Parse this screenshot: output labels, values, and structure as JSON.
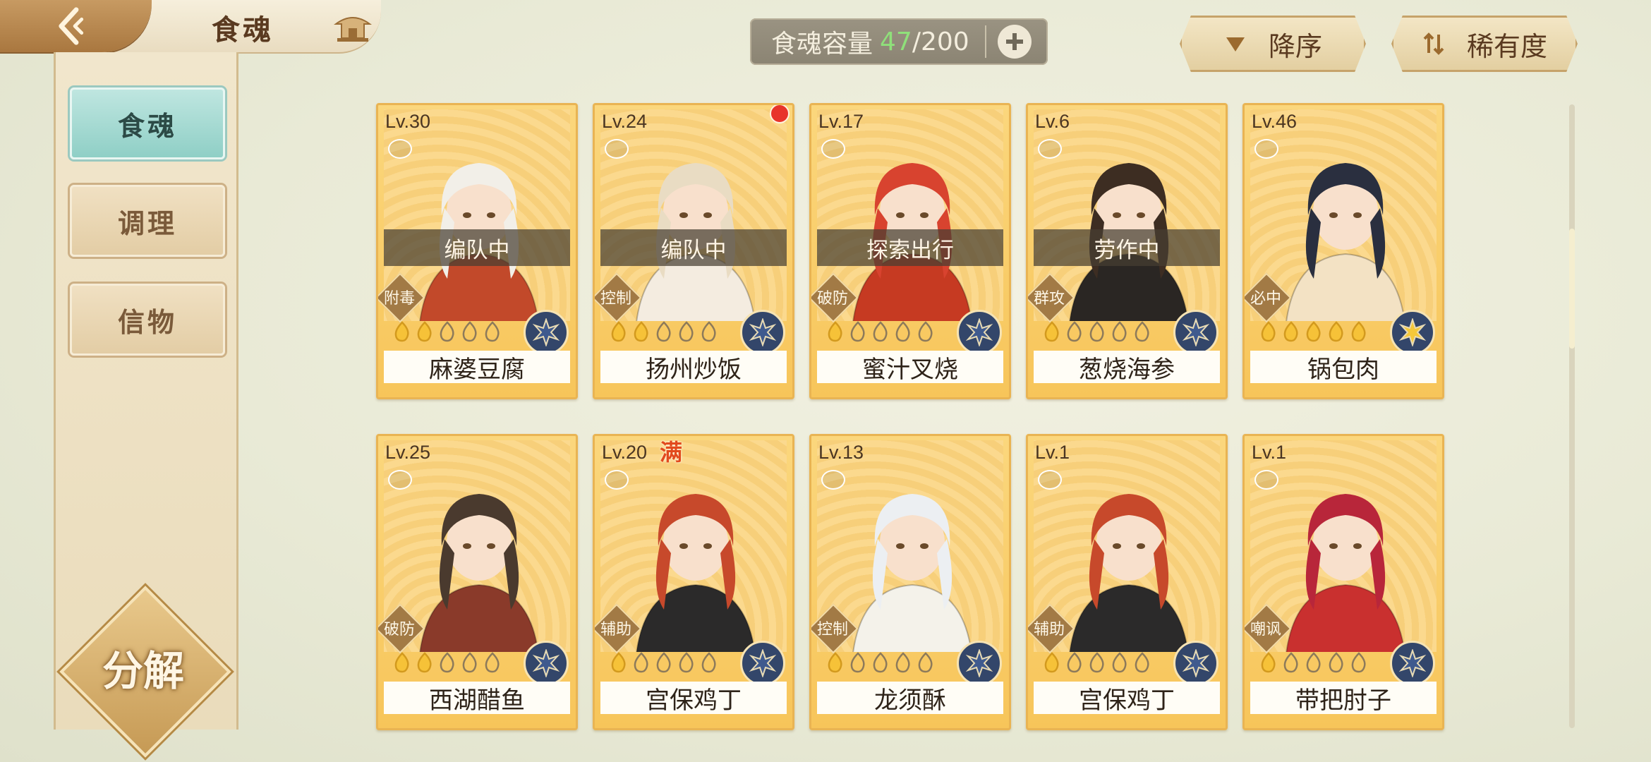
{
  "header": {
    "title": "食魂",
    "capacity_label": "食魂容量",
    "capacity_current": "47",
    "capacity_max": "/200",
    "sort_desc_label": "降序",
    "sort_rarity_label": "稀有度"
  },
  "sidebar": {
    "tabs": [
      {
        "label": "食魂",
        "active": true
      },
      {
        "label": "调理",
        "active": false
      },
      {
        "label": "信物",
        "active": false
      }
    ],
    "decompose_label": "分解"
  },
  "cards": [
    {
      "level": "Lv.30",
      "name": "麻婆豆腐",
      "status": "编队中",
      "role": "附毒",
      "stars_filled": 2,
      "stars_total": 5,
      "hair": "#f2efe8",
      "outfit": "#c2492a",
      "element": "blue"
    },
    {
      "level": "Lv.24",
      "name": "扬州炒饭",
      "status": "编队中",
      "role": "控制",
      "stars_filled": 2,
      "stars_total": 5,
      "hair": "#e9dcc3",
      "outfit": "#f4ece0",
      "element": "blue",
      "new_dot": true
    },
    {
      "level": "Lv.17",
      "name": "蜜汁叉烧",
      "status": "探索出行",
      "role": "破防",
      "stars_filled": 1,
      "stars_total": 5,
      "hair": "#d8432f",
      "outfit": "#c63a22",
      "element": "blue"
    },
    {
      "level": "Lv.6",
      "name": "葱烧海参",
      "status": "劳作中",
      "role": "群攻",
      "stars_filled": 1,
      "stars_total": 5,
      "hair": "#3d2d22",
      "outfit": "#2a2623",
      "element": "blue"
    },
    {
      "level": "Lv.46",
      "name": "锅包肉",
      "status": "",
      "role": "必中",
      "stars_filled": 5,
      "stars_total": 5,
      "hair": "#2a2f3f",
      "outfit": "#f3e2c4",
      "element": "gold"
    },
    {
      "level": "Lv.25",
      "name": "西湖醋鱼",
      "status": "",
      "role": "破防",
      "stars_filled": 2,
      "stars_total": 5,
      "hair": "#4a3a2e",
      "outfit": "#8a3a2a",
      "element": "blue"
    },
    {
      "level": "Lv.20",
      "name": "宫保鸡丁",
      "status": "",
      "role": "辅助",
      "stars_filled": 1,
      "stars_total": 5,
      "hair": "#c7492b",
      "outfit": "#2b2a2a",
      "element": "blue",
      "full_badge": "满"
    },
    {
      "level": "Lv.13",
      "name": "龙须酥",
      "status": "",
      "role": "控制",
      "stars_filled": 1,
      "stars_total": 5,
      "hair": "#eceff2",
      "outfit": "#f4f2ea",
      "element": "blue"
    },
    {
      "level": "Lv.1",
      "name": "宫保鸡丁",
      "status": "",
      "role": "辅助",
      "stars_filled": 1,
      "stars_total": 5,
      "hair": "#c7492b",
      "outfit": "#2b2a2a",
      "element": "blue"
    },
    {
      "level": "Lv.1",
      "name": "带把肘子",
      "status": "",
      "role": "嘲讽",
      "stars_filled": 1,
      "stars_total": 5,
      "hair": "#b8263a",
      "outfit": "#c9302f",
      "element": "blue"
    }
  ],
  "colors": {
    "accent_green": "#8fe07a",
    "card_gold": "#f7c55a",
    "active_tab": "#8fcfc6"
  },
  "icons": [
    "back-arrow-icon",
    "pavilion-icon",
    "plus-icon",
    "sort-desc-icon",
    "sort-rarity-icon",
    "element-icon",
    "flame-star-icon"
  ]
}
